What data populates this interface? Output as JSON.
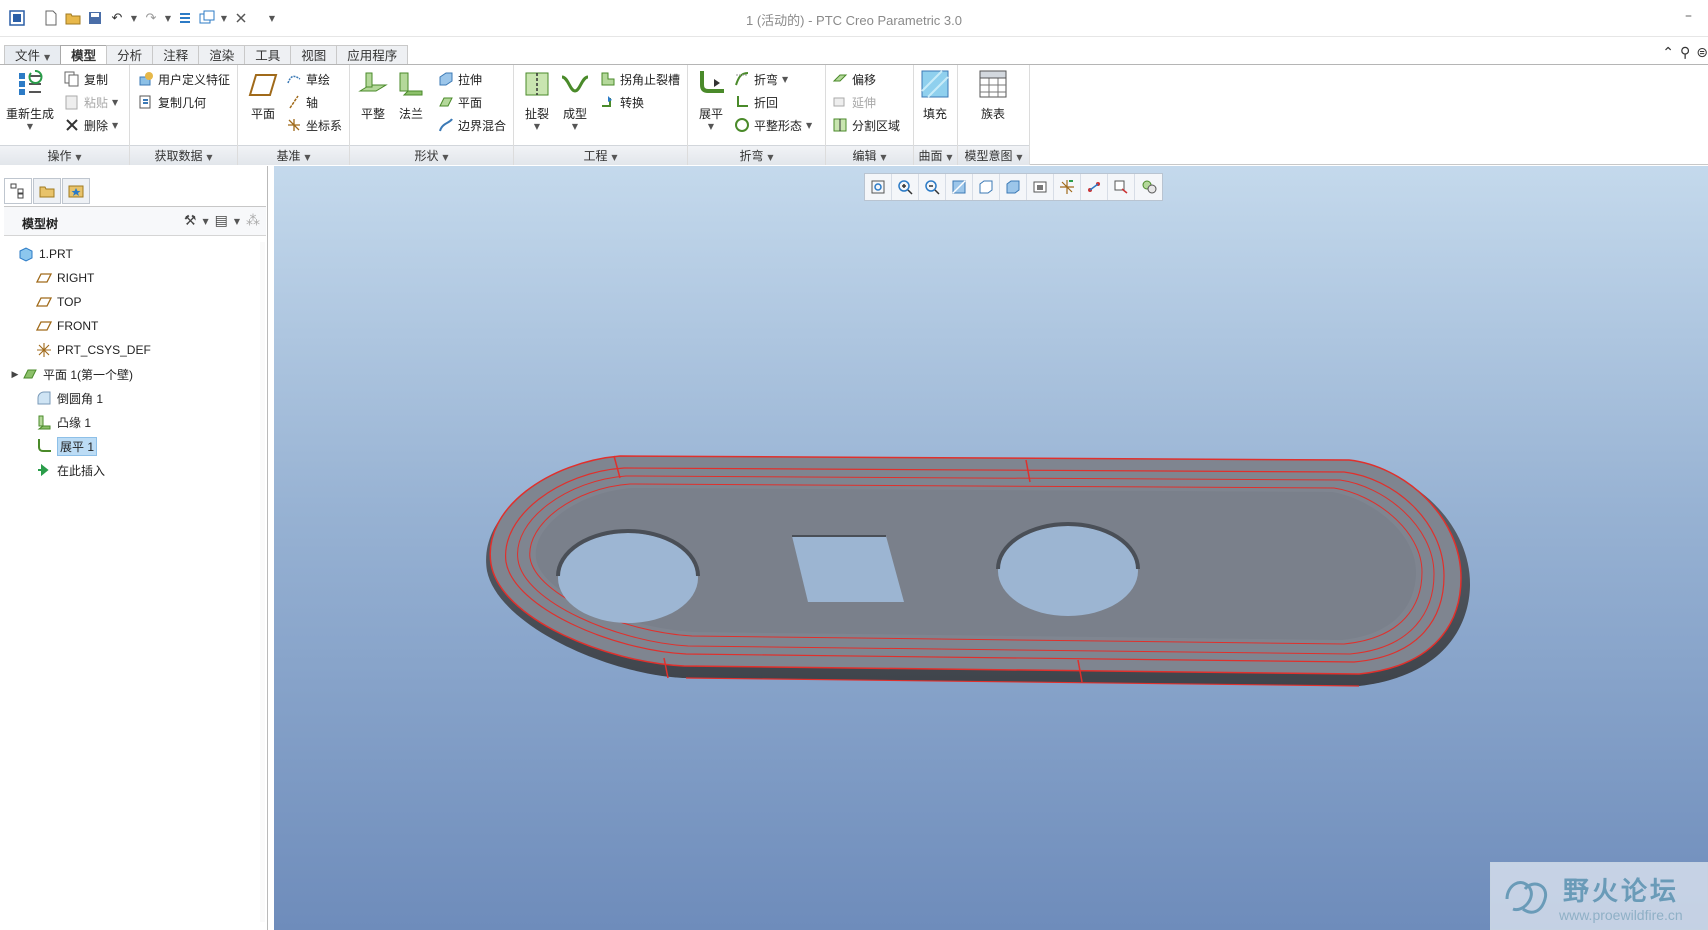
{
  "app": {
    "title": "1 (活动的) - PTC Creo Parametric 3.0"
  },
  "tabs": [
    "文件",
    "模型",
    "分析",
    "注释",
    "渲染",
    "工具",
    "视图",
    "应用程序"
  ],
  "ribbon": {
    "groups": [
      "操作",
      "获取数据",
      "基准",
      "形状",
      "工程",
      "折弯",
      "编辑",
      "曲面",
      "模型意图"
    ],
    "operations": {
      "regenerate": "重新生成",
      "copy": "复制",
      "paste": "粘贴",
      "delete": "删除"
    },
    "get_data": {
      "udf": "用户定义特征",
      "copy_geom": "复制几何"
    },
    "datum": {
      "plane": "平面",
      "sketch": "草绘",
      "axis": "轴",
      "csys": "坐标系"
    },
    "shapes": {
      "flat": "平整",
      "flange": "法兰",
      "extrude": "拉伸",
      "plane": "平面",
      "boundary_blend": "边界混合"
    },
    "engineering": {
      "rip": "扯裂",
      "form": "成型",
      "corner_relief": "拐角止裂槽",
      "convert": "转换"
    },
    "bend": {
      "unbend": "展平",
      "bend": "折弯",
      "bend_back": "折回",
      "flat_pattern": "平整形态"
    },
    "edit": {
      "offset": "偏移",
      "extend": "延伸",
      "split_area": "分割区域"
    },
    "surfaces": {
      "fill": "填充"
    },
    "model_intent": {
      "family_table": "族表"
    }
  },
  "model_tree": {
    "title": "模型树",
    "items": [
      {
        "label": "1.PRT",
        "icon": "part-icon"
      },
      {
        "label": "RIGHT",
        "icon": "datum-plane-icon"
      },
      {
        "label": "TOP",
        "icon": "datum-plane-icon"
      },
      {
        "label": "FRONT",
        "icon": "datum-plane-icon"
      },
      {
        "label": "PRT_CSYS_DEF",
        "icon": "csys-icon"
      },
      {
        "label": "平面 1(第一个壁)",
        "icon": "flat-wall-icon",
        "expandable": true
      },
      {
        "label": "倒圆角 1",
        "icon": "round-icon"
      },
      {
        "label": "凸缘 1",
        "icon": "flange-icon"
      },
      {
        "label": "展平 1",
        "icon": "unbend-icon",
        "selected": true
      },
      {
        "label": "在此插入",
        "icon": "insert-here-icon"
      }
    ]
  },
  "watermark": {
    "title": "野火论坛",
    "url": "www.proewildfire.cn"
  },
  "colors": {
    "viewport_top": "#c4d9ec",
    "viewport_bottom": "#6e8cbb",
    "part_gray": "#7f8590",
    "edge_red": "#e0302c",
    "selection": "#bcdcf5"
  }
}
